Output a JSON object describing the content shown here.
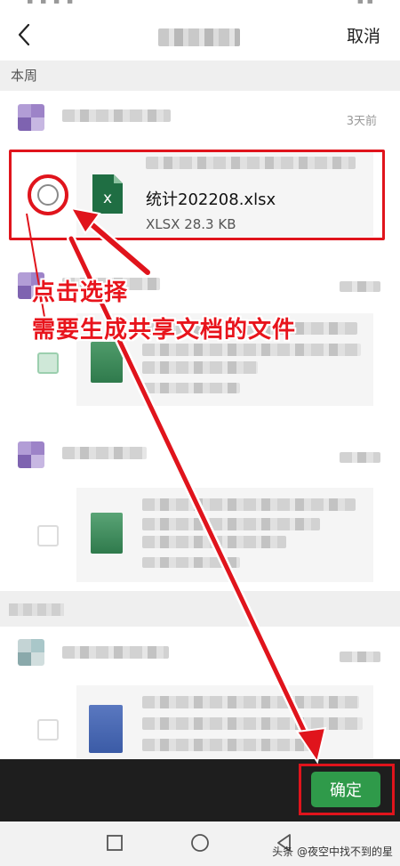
{
  "header": {
    "cancel_label": "取消"
  },
  "section": {
    "label": "本周"
  },
  "messages": [
    {
      "time": "3天前"
    }
  ],
  "selected_file": {
    "name": "统计202208.xlsx",
    "meta": "XLSX 28.3 KB",
    "icon_letter": "x"
  },
  "annotation": {
    "line1": "点击选择",
    "line2": "需要生成共享文档的文件"
  },
  "footer": {
    "confirm_label": "确定"
  },
  "watermark": "头条 @夜空中找不到的星",
  "colors": {
    "excel_green": "#1f6e43",
    "confirm_green": "#2f9a4a",
    "annotation_red": "#e0141c"
  }
}
